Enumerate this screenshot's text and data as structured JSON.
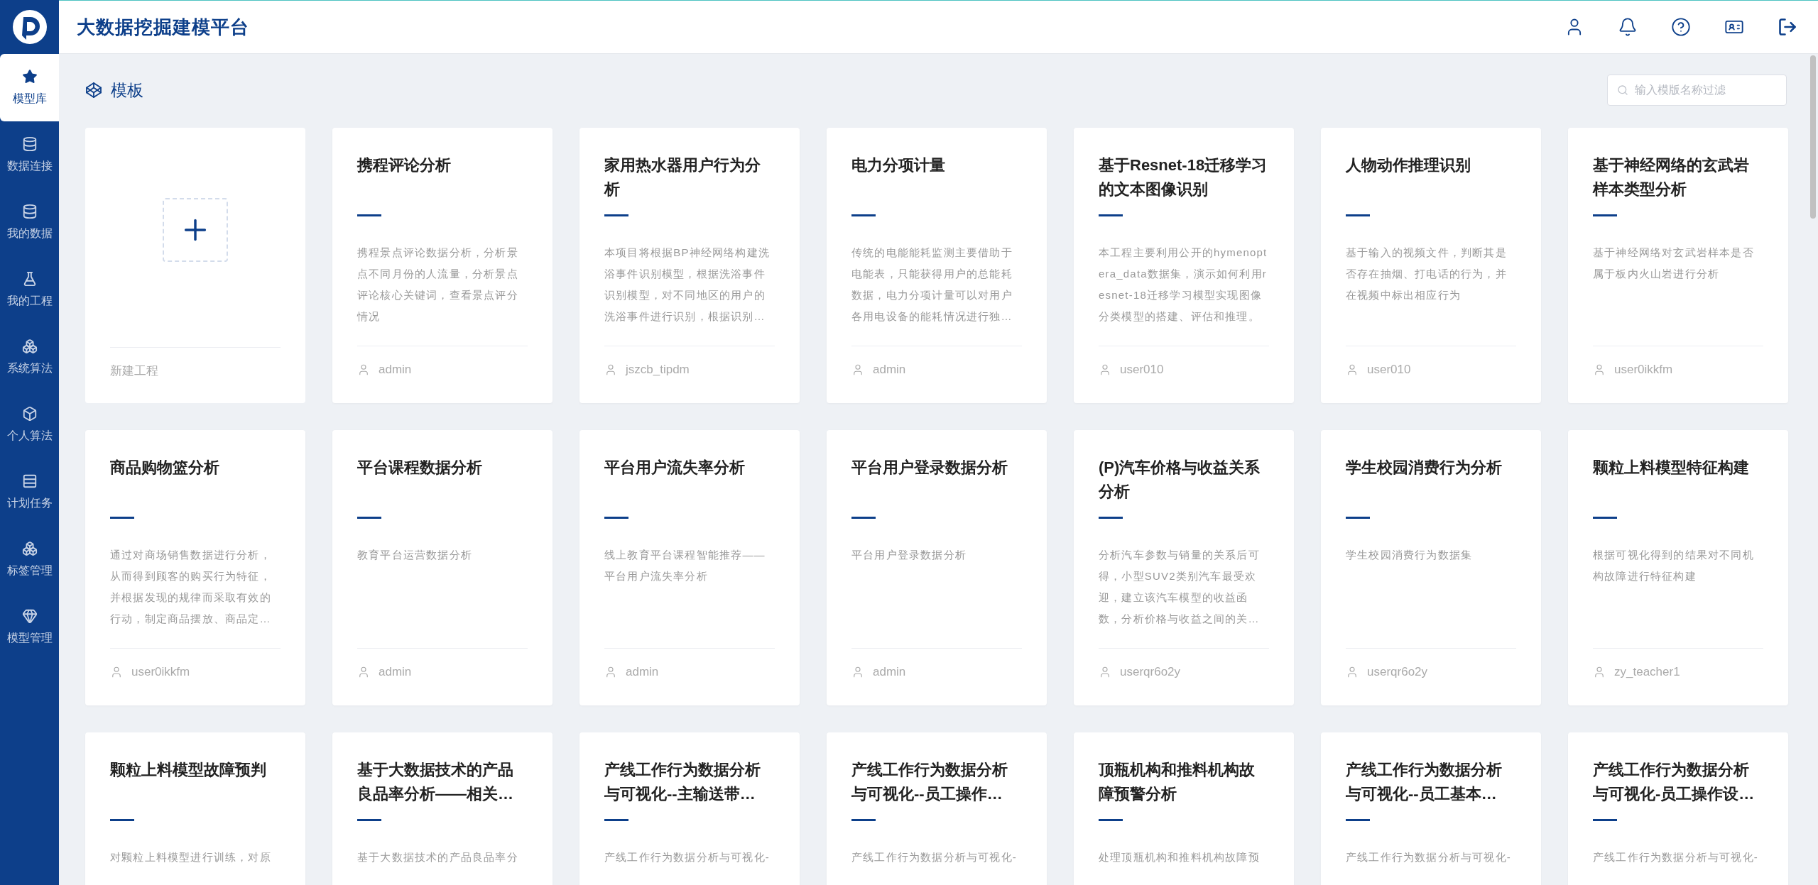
{
  "header": {
    "title": "大数据挖掘建模平台"
  },
  "sidebar": {
    "items": [
      {
        "label": "模型库",
        "selected": true
      },
      {
        "label": "数据连接",
        "selected": false
      },
      {
        "label": "我的数据",
        "selected": false
      },
      {
        "label": "我的工程",
        "selected": false
      },
      {
        "label": "系统算法",
        "selected": false
      },
      {
        "label": "个人算法",
        "selected": false
      },
      {
        "label": "计划任务",
        "selected": false
      },
      {
        "label": "标签管理",
        "selected": false
      },
      {
        "label": "模型管理",
        "selected": false
      }
    ]
  },
  "section": {
    "title": "模板"
  },
  "search": {
    "placeholder": "输入模版名称过滤"
  },
  "new_project": {
    "label": "新建工程"
  },
  "cards": [
    {
      "title": "携程评论分析",
      "description": "携程景点评论数据分析，分析景点不同月份的人流量，分析景点评论核心关键词，查看景点评分情况",
      "author": "admin"
    },
    {
      "title": "家用热水器用户行为分析",
      "description": "本项目将根据BP神经网络构建洗浴事件识别模型，根据洗浴事件识别模型，对不同地区的用户的洗浴事件进行识别，根据识别…",
      "author": "jszcb_tipdm"
    },
    {
      "title": "电力分项计量",
      "description": "传统的电能能耗监测主要借助于电能表，只能获得用户的总能耗数据，电力分项计量可以对用户各用电设备的能耗情况进行独…",
      "author": "admin"
    },
    {
      "title": "基于Resnet-18迁移学习的文本图像识别",
      "description": "本工程主要利用公开的hymenoptera_data数据集，演示如何利用resnet-18迁移学习模型实现图像分类模型的搭建、评估和推理。",
      "author": "user010"
    },
    {
      "title": "人物动作推理识别",
      "description": "基于输入的视频文件，判断其是否存在抽烟、打电话的行为，并在视频中标出相应行为",
      "author": "user010"
    },
    {
      "title": "基于神经网络的玄武岩样本类型分析",
      "description": "基于神经网络对玄武岩样本是否属于板内火山岩进行分析",
      "author": "user0ikkfm"
    },
    {
      "title": "商品购物篮分析",
      "description": "通过对商场销售数据进行分析，从而得到顾客的购买行为特征，并根据发现的规律而采取有效的行动，制定商品摆放、商品定…",
      "author": "user0ikkfm"
    },
    {
      "title": "平台课程数据分析",
      "description": "教育平台运营数据分析",
      "author": "admin"
    },
    {
      "title": "平台用户流失率分析",
      "description": "线上教育平台课程智能推荐——平台用户流失率分析",
      "author": "admin"
    },
    {
      "title": "平台用户登录数据分析",
      "description": "平台用户登录数据分析",
      "author": "admin"
    },
    {
      "title": "(P)汽车价格与收益关系分析",
      "description": "分析汽车参数与销量的关系后可得，小型SUV2类别汽车最受欢迎，建立该汽车模型的收益函数，分析价格与收益之间的关…",
      "author": "userqr6o2y"
    },
    {
      "title": "学生校园消费行为分析",
      "description": "学生校园消费行为数据集",
      "author": "userqr6o2y"
    },
    {
      "title": "颗粒上料模型特征构建",
      "description": "根据可视化得到的结果对不同机构故障进行特征构建",
      "author": "zy_teacher1"
    },
    {
      "title": "颗粒上料模型故障预判",
      "description": "对颗粒上料模型进行训练，对原"
    },
    {
      "title": "基于大数据技术的产品良品率分析——相关…",
      "description": "基于大数据技术的产品良品率分"
    },
    {
      "title": "产线工作行为数据分析与可视化--主输送带…",
      "description": "产线工作行为数据分析与可视化-"
    },
    {
      "title": "产线工作行为数据分析与可视化--员工操作…",
      "description": "产线工作行为数据分析与可视化-"
    },
    {
      "title": "顶瓶机构和推料机构故障预警分析",
      "description": "处理顶瓶机构和推料机构故障预"
    },
    {
      "title": "产线工作行为数据分析与可视化--员工基本…",
      "description": "产线工作行为数据分析与可视化-"
    },
    {
      "title": "产线工作行为数据分析与可视化-员工操作设…",
      "description": "产线工作行为数据分析与可视化-"
    }
  ]
}
